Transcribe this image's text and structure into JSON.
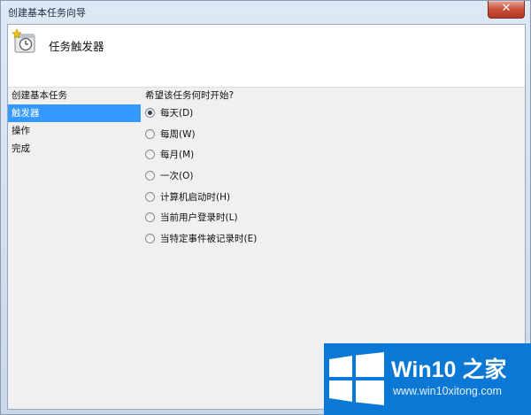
{
  "window": {
    "title": "创建基本任务向导",
    "close_icon": "close-icon"
  },
  "header": {
    "title": "任务触发器",
    "icon": "task-scheduler-clock-icon"
  },
  "sidebar": {
    "items": [
      {
        "label": "创建基本任务",
        "selected": false
      },
      {
        "label": "触发器",
        "selected": true
      },
      {
        "label": "操作",
        "selected": false
      },
      {
        "label": "完成",
        "selected": false
      }
    ]
  },
  "main": {
    "question": "希望该任务何时开始?",
    "options": [
      {
        "label": "每天(D)",
        "checked": true
      },
      {
        "label": "每周(W)",
        "checked": false
      },
      {
        "label": "每月(M)",
        "checked": false
      },
      {
        "label": "一次(O)",
        "checked": false
      },
      {
        "label": "计算机启动时(H)",
        "checked": false
      },
      {
        "label": "当前用户登录时(L)",
        "checked": false
      },
      {
        "label": "当特定事件被记录时(E)",
        "checked": false
      }
    ]
  },
  "watermark": {
    "title": "Win10 之家",
    "url": "www.win10xitong.com",
    "logo_icon": "windows-logo-icon",
    "background_color": "#0a78d4"
  },
  "colors": {
    "selection": "#3399ff",
    "close_button": "#c74a35"
  }
}
